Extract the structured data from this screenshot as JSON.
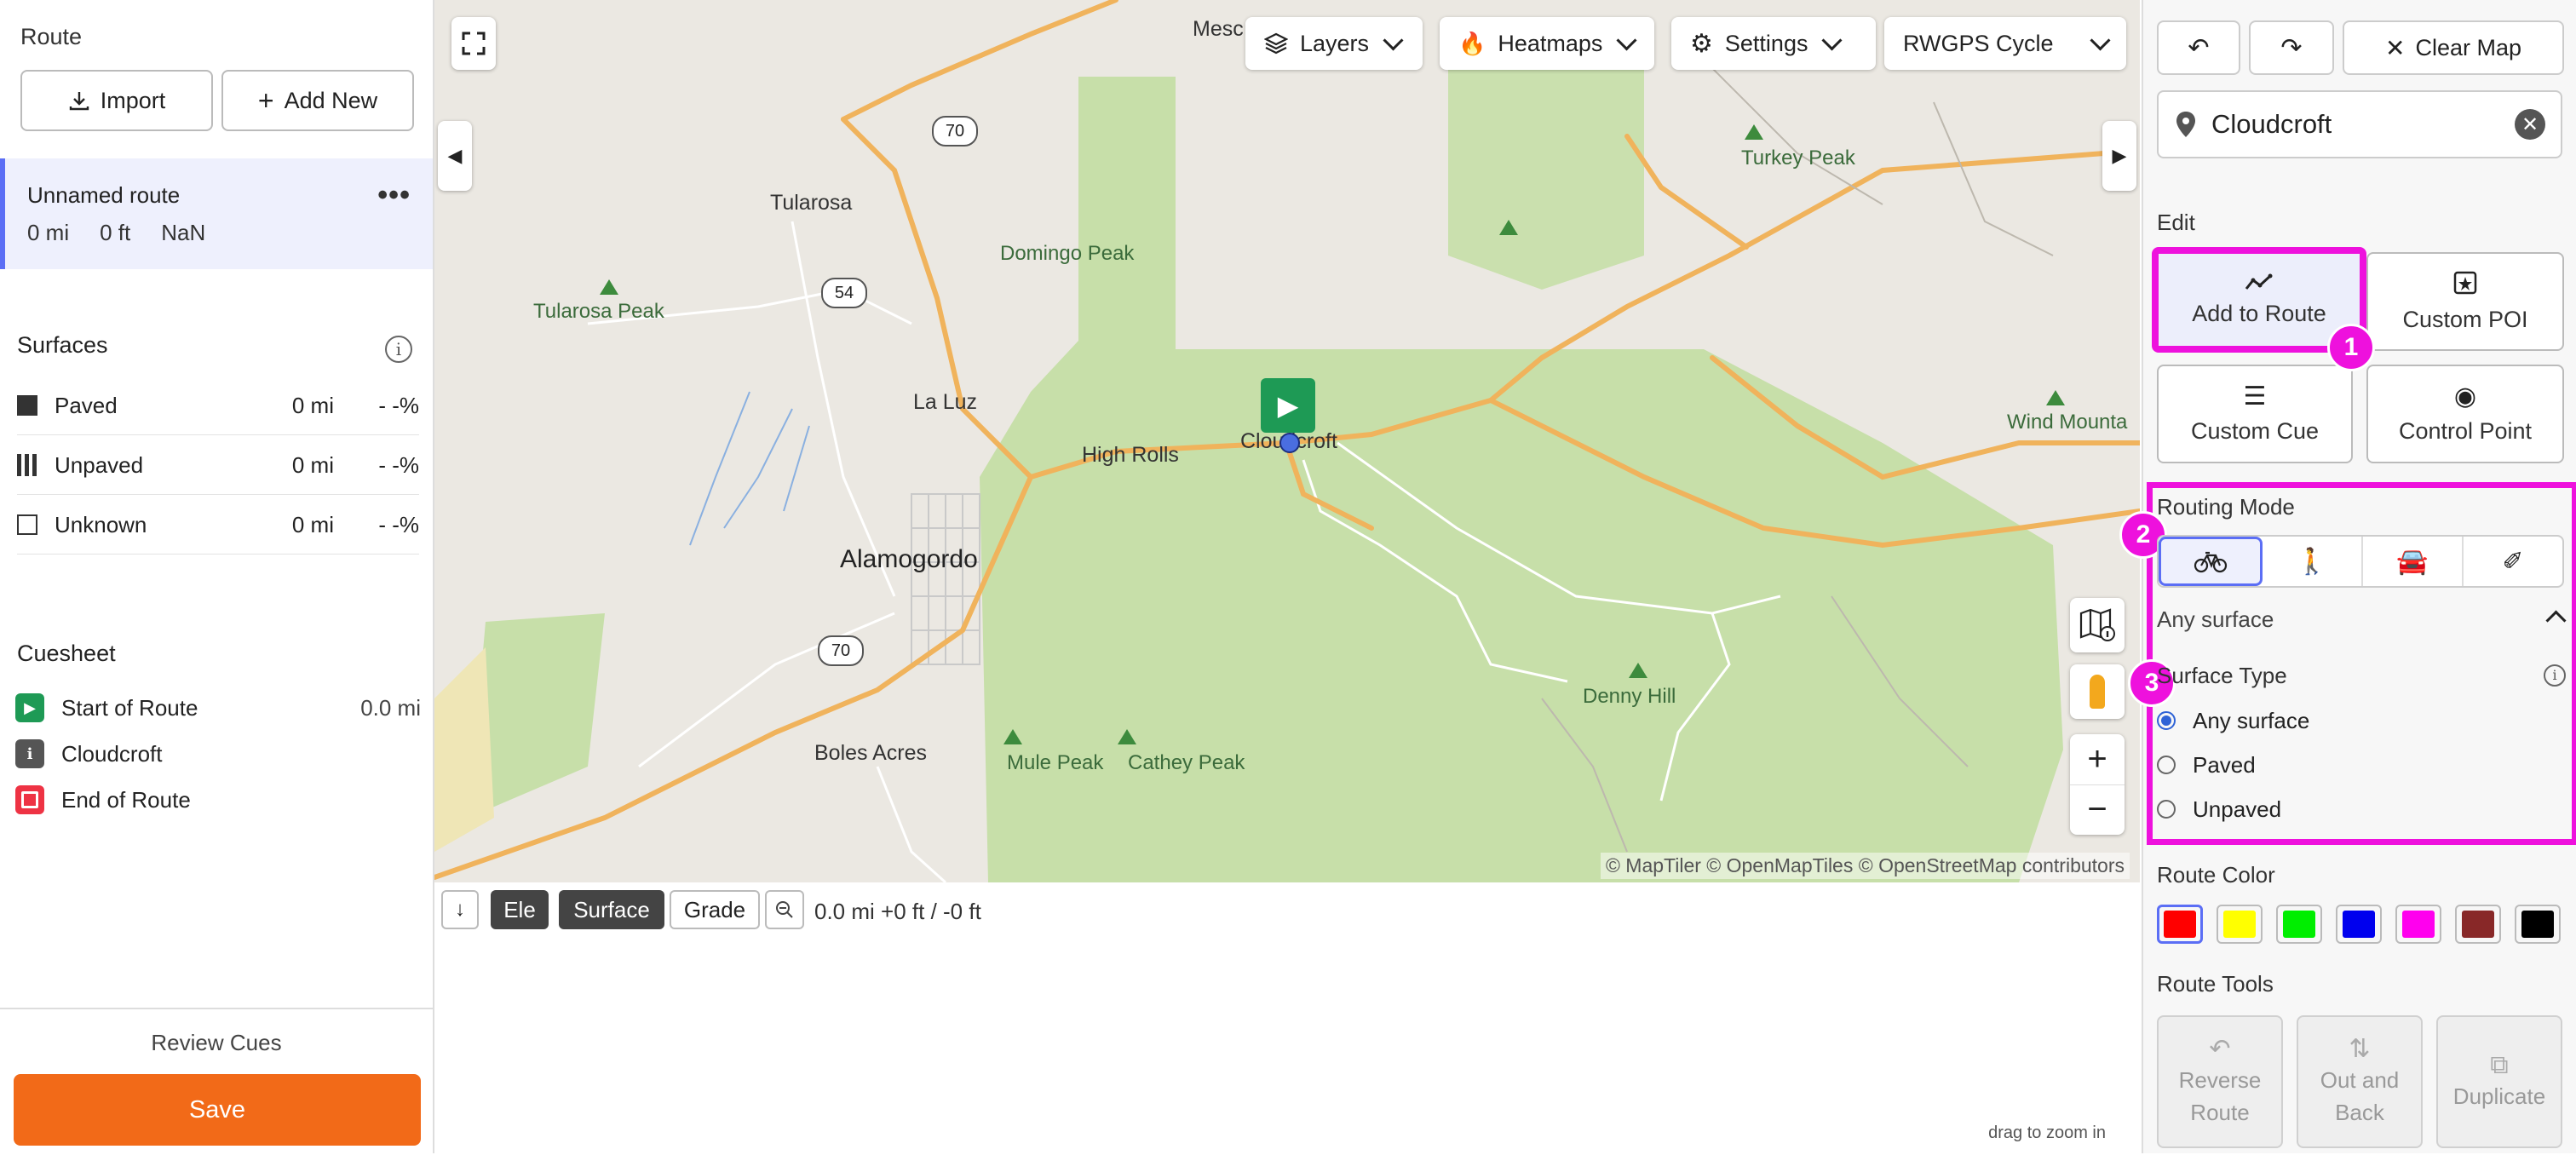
{
  "left": {
    "route_heading": "Route",
    "import_label": "Import",
    "add_new_label": "Add New",
    "route_card": {
      "name": "Unnamed route",
      "distance": "0 mi",
      "elevation": "0 ft",
      "extra": "NaN"
    },
    "surfaces": {
      "title": "Surfaces",
      "rows": [
        {
          "label": "Paved",
          "distance": "0 mi",
          "percent": "- -%"
        },
        {
          "label": "Unpaved",
          "distance": "0 mi",
          "percent": "- -%"
        },
        {
          "label": "Unknown",
          "distance": "0 mi",
          "percent": "- -%"
        }
      ]
    },
    "cuesheet": {
      "title": "Cuesheet",
      "items": [
        {
          "label": "Start of Route",
          "distance": "0.0 mi",
          "color": "#1e9a55"
        },
        {
          "label": "Cloudcroft",
          "distance": "",
          "color": "#555555"
        },
        {
          "label": "End of Route",
          "distance": "",
          "color": "#ee3344"
        }
      ]
    },
    "review_cues": "Review Cues",
    "save_label": "Save"
  },
  "map": {
    "dropdowns": {
      "layers": "Layers",
      "heatmaps": "Heatmaps",
      "settings": "Settings",
      "basemap": "RWGPS Cycle"
    },
    "places": {
      "mesc": "Mesc",
      "tularosa": "Tularosa",
      "la_luz": "La Luz",
      "high_rolls": "High Rolls",
      "cloudcroft": "Cloudcroft",
      "alamogordo": "Alamogordo",
      "boles_acres": "Boles Acres",
      "wind_mounta": "Wind Mounta"
    },
    "peaks": {
      "domingo": "Domingo Peak",
      "tularosa_peak": "Tularosa Peak",
      "turkey": "Turkey Peak",
      "mule": "Mule Peak",
      "cathey": "Cathey Peak",
      "denny": "Denny Hill"
    },
    "shields": {
      "r70a": "70",
      "r54": "54",
      "r70b": "70"
    },
    "attribution": "© MapTiler © OpenMapTiles © OpenStreetMap contributors"
  },
  "elevation": {
    "ele_label": "Ele",
    "surface_label": "Surface",
    "grade_label": "Grade",
    "stats": "0.0 mi +0 ft / -0 ft",
    "drag_hint": "drag to zoom in"
  },
  "right": {
    "clear_map": "Clear Map",
    "location": "Cloudcroft",
    "edit_title": "Edit",
    "edit_buttons": {
      "add_to_route": "Add to Route",
      "custom_poi": "Custom POI",
      "custom_cue": "Custom Cue",
      "control_point": "Control Point"
    },
    "routing_mode_title": "Routing Mode",
    "surface_selected": "Any surface",
    "surface_type_title": "Surface Type",
    "surface_options": [
      "Any surface",
      "Paved",
      "Unpaved"
    ],
    "route_color_title": "Route Color",
    "route_colors": [
      "#ff0000",
      "#ffff00",
      "#00ee00",
      "#0000ee",
      "#ff00ee",
      "#882828",
      "#000000"
    ],
    "route_tools_title": "Route Tools",
    "tools": {
      "reverse_1": "Reverse",
      "reverse_2": "Route",
      "outback_1": "Out and",
      "outback_2": "Back",
      "duplicate": "Duplicate"
    },
    "badges": [
      "1",
      "2",
      "3"
    ],
    "highlight_color": "#ee11dd"
  }
}
